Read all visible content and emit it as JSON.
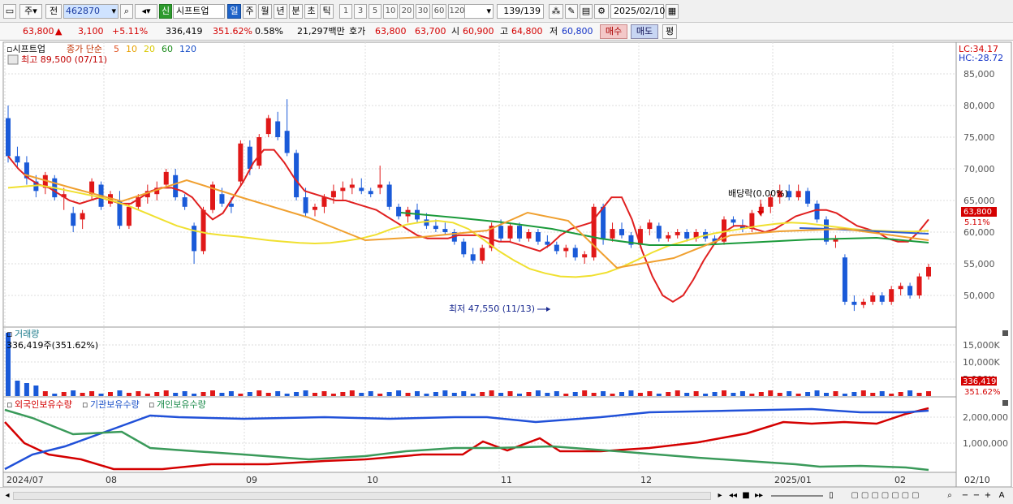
{
  "toolbar": {
    "market": "주",
    "prev_label": "전",
    "code": "462870",
    "badge": "신",
    "name": "시프트업",
    "periods": [
      "일",
      "주",
      "월",
      "년",
      "분",
      "초",
      "틱"
    ],
    "active_period": "일",
    "intervals": [
      "1",
      "3",
      "5",
      "10",
      "20",
      "30",
      "60",
      "120"
    ],
    "count": "139",
    "count_total": "/139",
    "date": "2025/02/10"
  },
  "quote": {
    "price": "63,800",
    "arrow": "▲",
    "change": "3,100",
    "change_pct": "+5.11%",
    "volume": "336,419",
    "volume_pct": "351.62%",
    "turnover_pct": "0.58%",
    "trade_value": "21,297백만",
    "bid_label": "호가",
    "ask": "63,800",
    "bid": "63,700",
    "open_label": "시",
    "open": "60,900",
    "high_label": "고",
    "high": "64,800",
    "low_label": "저",
    "low": "60,800",
    "buy": "매수",
    "sell": "매도",
    "eval": "평"
  },
  "price_panel": {
    "legend_name": "시프트업",
    "legend_series": "종가 단순",
    "ma_labels": [
      {
        "text": "5",
        "color": "#e05020"
      },
      {
        "text": "10",
        "color": "#e8a000"
      },
      {
        "text": "20",
        "color": "#d8c800"
      },
      {
        "text": "60",
        "color": "#1a8a1a"
      },
      {
        "text": "120",
        "color": "#1a50c8"
      }
    ],
    "high_note": "최고 89,500 (07/11)",
    "low_note": "최저 47,550 (11/13)",
    "dividend_note": "배당락(0.00%)",
    "lc": "LC:34.17",
    "hc": "HC:-28.72",
    "last_price": "63,800",
    "last_pct": "5.11%",
    "y_labels": [
      "85,000",
      "80,000",
      "75,000",
      "70,000",
      "65,000",
      "60,000",
      "55,000",
      "50,000"
    ]
  },
  "volume_panel": {
    "title": "거래량",
    "value": "336,419주(351.62%)",
    "y_labels": [
      "15,000K",
      "10,000K",
      "5,000K"
    ],
    "last_value": "336,419",
    "last_pct": "351.62%"
  },
  "holding_panel": {
    "legend": [
      {
        "text": "외국인보유수량",
        "color": "#d40000"
      },
      {
        "text": "기관보유수량",
        "color": "#1a50c8"
      },
      {
        "text": "개인보유수량",
        "color": "#1a8a4a"
      }
    ],
    "y_labels": [
      "2,000,000",
      "1,000,000"
    ]
  },
  "x_labels": [
    "2024/07",
    "08",
    "09",
    "10",
    "11",
    "12",
    "2025/01",
    "02",
    "02/10"
  ],
  "chart_data": {
    "type": "candlestick",
    "ylim": [
      45000,
      90000
    ],
    "candles": [
      [
        78000,
        80000,
        71000,
        72000
      ],
      [
        72000,
        73500,
        70000,
        71000
      ],
      [
        71000,
        72000,
        67500,
        68500
      ],
      [
        68000,
        69000,
        65500,
        66500
      ],
      [
        67000,
        69500,
        66000,
        69000
      ],
      [
        68500,
        69000,
        65000,
        65500
      ],
      [
        65500,
        67000,
        63500,
        66000
      ],
      [
        63000,
        64000,
        60000,
        61000
      ],
      [
        62000,
        63500,
        60500,
        63000
      ],
      [
        66000,
        68500,
        65000,
        68000
      ],
      [
        67500,
        68000,
        63500,
        64000
      ],
      [
        64500,
        66500,
        64000,
        66000
      ],
      [
        65000,
        66500,
        60500,
        61000
      ],
      [
        61000,
        64500,
        60500,
        64000
      ],
      [
        64000,
        66000,
        63500,
        65500
      ],
      [
        65500,
        67500,
        64500,
        66500
      ],
      [
        66000,
        68000,
        65000,
        67000
      ],
      [
        67500,
        70000,
        67000,
        69500
      ],
      [
        69000,
        70000,
        65000,
        65500
      ],
      [
        65500,
        66000,
        63500,
        64000
      ],
      [
        61000,
        61500,
        55000,
        57000
      ],
      [
        57000,
        64000,
        56500,
        63500
      ],
      [
        63500,
        68000,
        63000,
        67500
      ],
      [
        66000,
        67000,
        64000,
        64500
      ],
      [
        64500,
        65500,
        63000,
        64000
      ],
      [
        68000,
        74500,
        67500,
        74000
      ],
      [
        73500,
        74500,
        69000,
        70000
      ],
      [
        70500,
        75500,
        70000,
        75000
      ],
      [
        75500,
        78500,
        75000,
        78000
      ],
      [
        77500,
        79000,
        74500,
        75000
      ],
      [
        76000,
        81000,
        72000,
        72500
      ],
      [
        72500,
        73000,
        65000,
        65500
      ],
      [
        65500,
        67000,
        62500,
        63000
      ],
      [
        63500,
        64500,
        62500,
        64000
      ],
      [
        64000,
        66000,
        63000,
        65500
      ],
      [
        65500,
        67500,
        64500,
        66500
      ],
      [
        66500,
        68000,
        65000,
        67000
      ],
      [
        67000,
        68500,
        66000,
        67500
      ],
      [
        67000,
        68500,
        66000,
        66500
      ],
      [
        66500,
        67000,
        65500,
        66000
      ],
      [
        67000,
        70500,
        66000,
        67500
      ],
      [
        67500,
        68000,
        63500,
        64000
      ],
      [
        64000,
        64500,
        62000,
        62500
      ],
      [
        62500,
        64000,
        61500,
        63500
      ],
      [
        63500,
        64500,
        61500,
        62000
      ],
      [
        62000,
        63000,
        60500,
        61000
      ],
      [
        61000,
        62000,
        60000,
        60500
      ],
      [
        60500,
        61500,
        59500,
        60000
      ],
      [
        60000,
        60500,
        58000,
        58500
      ],
      [
        58500,
        59000,
        56000,
        56500
      ],
      [
        56500,
        57500,
        55000,
        55500
      ],
      [
        55500,
        58000,
        55000,
        57500
      ],
      [
        57500,
        61500,
        57000,
        61000
      ],
      [
        61000,
        62000,
        58500,
        59000
      ],
      [
        59000,
        61500,
        58500,
        61000
      ],
      [
        61000,
        61500,
        58500,
        59000
      ],
      [
        59000,
        60500,
        58500,
        60000
      ],
      [
        60000,
        60500,
        58000,
        58500
      ],
      [
        58500,
        59500,
        57500,
        58000
      ],
      [
        58000,
        58500,
        56500,
        57000
      ],
      [
        57000,
        58000,
        56000,
        57500
      ],
      [
        57500,
        58000,
        55500,
        56000
      ],
      [
        56000,
        57000,
        55000,
        56500
      ],
      [
        56000,
        64500,
        55500,
        64000
      ],
      [
        64000,
        64500,
        58000,
        59000
      ],
      [
        59000,
        61500,
        58500,
        60500
      ],
      [
        60500,
        61500,
        59000,
        59500
      ],
      [
        59500,
        60000,
        57500,
        58000
      ],
      [
        58000,
        61000,
        57500,
        60500
      ],
      [
        60500,
        62000,
        59500,
        61500
      ],
      [
        61000,
        61500,
        58500,
        59000
      ],
      [
        59000,
        60000,
        58500,
        59500
      ],
      [
        59500,
        60500,
        59000,
        60000
      ],
      [
        60000,
        60500,
        58500,
        59000
      ],
      [
        59000,
        60500,
        58500,
        60000
      ],
      [
        60000,
        60500,
        58500,
        59000
      ],
      [
        59000,
        59500,
        58000,
        58500
      ],
      [
        58500,
        62500,
        58000,
        62000
      ],
      [
        62000,
        62500,
        61000,
        61500
      ],
      [
        61000,
        62000,
        60000,
        60500
      ],
      [
        60500,
        63500,
        60000,
        63000
      ],
      [
        63000,
        64500,
        62500,
        64000
      ],
      [
        64000,
        66000,
        63000,
        65500
      ],
      [
        65500,
        67500,
        64500,
        66500
      ],
      [
        66500,
        67500,
        65000,
        65500
      ],
      [
        65500,
        67500,
        65000,
        66500
      ],
      [
        66500,
        67000,
        64000,
        64500
      ],
      [
        64500,
        65000,
        61500,
        62000
      ],
      [
        62000,
        62500,
        58000,
        58500
      ],
      [
        58500,
        59500,
        57500,
        59000
      ],
      [
        56000,
        56500,
        48500,
        49000
      ],
      [
        49000,
        50000,
        47550,
        48500
      ],
      [
        48500,
        49500,
        48000,
        49000
      ],
      [
        49000,
        50500,
        48500,
        50000
      ],
      [
        50000,
        50500,
        48500,
        49000
      ],
      [
        49000,
        51500,
        48500,
        51000
      ],
      [
        51000,
        52000,
        50000,
        51500
      ],
      [
        51500,
        52000,
        49500,
        50000
      ],
      [
        50000,
        53500,
        49500,
        53000
      ],
      [
        53000,
        55000,
        52500,
        54500
      ]
    ],
    "ma": {
      "ma5": [
        72000,
        70000,
        68500,
        67500,
        67000,
        66000,
        65000,
        64500,
        65000,
        65500,
        65000,
        64500,
        64500,
        65500,
        66500,
        67000,
        67000,
        66500,
        65500,
        63500,
        62000,
        63000,
        65500,
        68000,
        71000,
        73000,
        73000,
        71000,
        68500,
        66500,
        66000,
        65500,
        65000,
        65000,
        64500,
        64000,
        63500,
        62500,
        61500,
        60500,
        59500,
        59000,
        59000,
        59000,
        59500,
        59500,
        59500,
        59000,
        58500,
        58500,
        58000,
        57500,
        57000,
        58000,
        59500,
        60500,
        61000,
        61500,
        63500,
        65500,
        65500,
        62000,
        57000,
        53000,
        50000,
        49000,
        50000,
        52500,
        55500,
        58000,
        60000,
        61000,
        61000,
        60500,
        60000,
        60500,
        61500,
        62500,
        63000,
        63500,
        63500,
        63000,
        62000,
        61000,
        60500,
        60000,
        59000,
        58500,
        58500,
        60000,
        62000
      ],
      "ma20": [
        67000,
        67200,
        67400,
        67000,
        66500,
        66000,
        65500,
        64800,
        64000,
        63000,
        62000,
        61000,
        60300,
        59800,
        59500,
        59300,
        59000,
        58700,
        58500,
        58300,
        58200,
        58300,
        58600,
        59000,
        59600,
        60500,
        61200,
        61600,
        61800,
        61500,
        60500,
        58800,
        57000,
        55500,
        54200,
        53500,
        53000,
        52900,
        53100,
        53600,
        54500,
        55600,
        56800,
        57800,
        58500,
        59200,
        59800,
        60200,
        60600,
        61000,
        61300,
        61500,
        61400,
        61100,
        60800,
        60500,
        60300,
        60200,
        60100,
        60100,
        60200
      ]
    }
  }
}
